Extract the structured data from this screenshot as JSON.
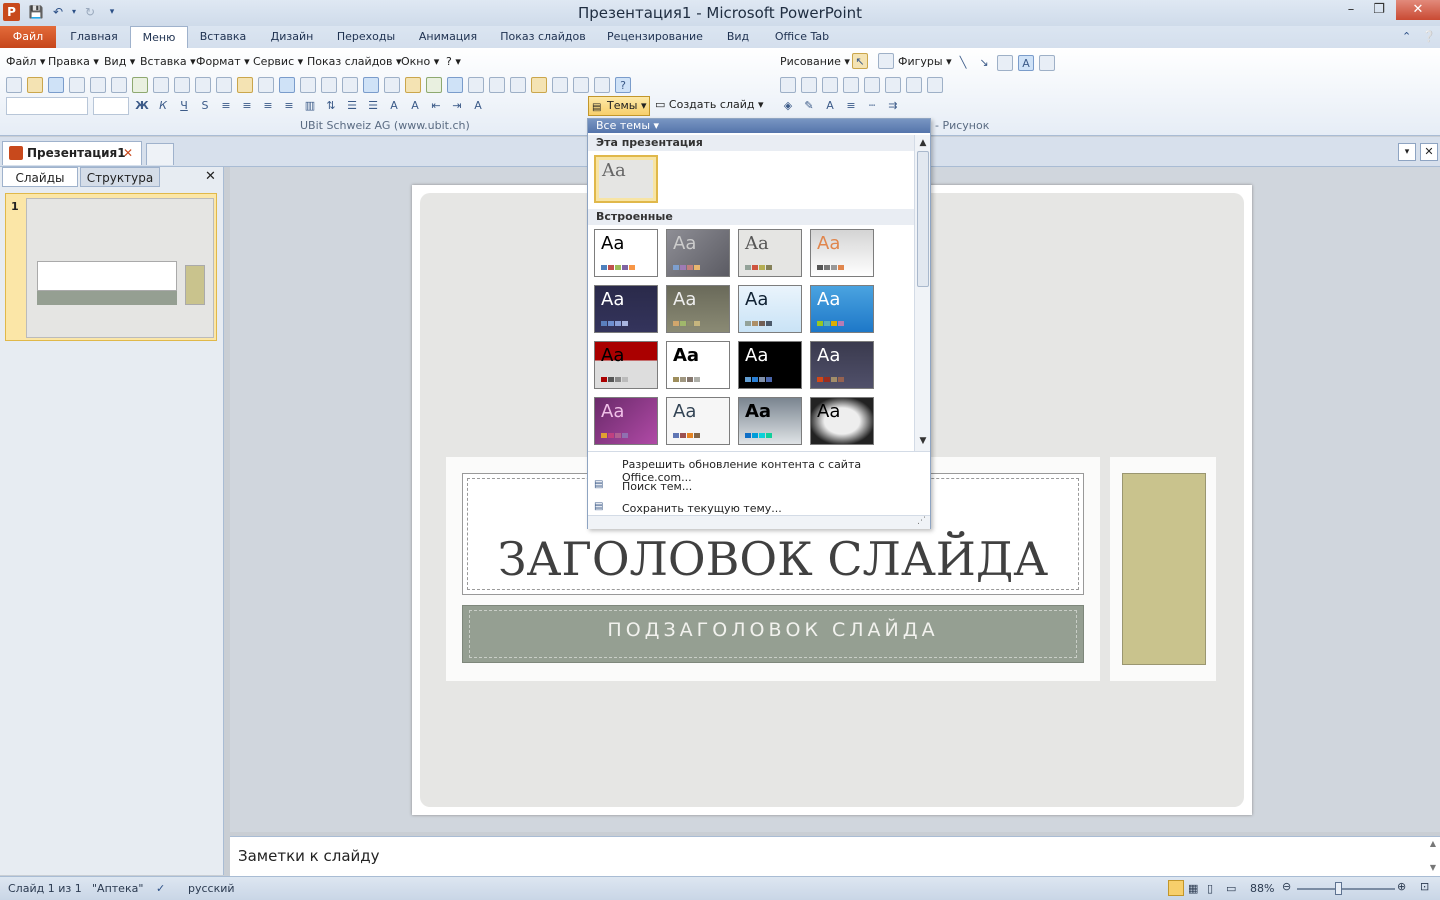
{
  "window": {
    "title": "Презентация1 - Microsoft PowerPoint",
    "app_icon_letter": "P"
  },
  "ribbon_tabs": [
    "Файл",
    "Главная",
    "Меню",
    "Вставка",
    "Дизайн",
    "Переходы",
    "Анимация",
    "Показ слайдов",
    "Рецензирование",
    "Вид",
    "Office Tab"
  ],
  "active_tab": "Меню",
  "menu_bar": [
    "Файл",
    "Правка",
    "Вид",
    "Вставка",
    "Формат",
    "Сервис",
    "Показ слайдов",
    "Окно",
    "?"
  ],
  "ribbon": {
    "caption": "UBit Schweiz AG    (www.ubit.ch)",
    "picture_group": "Рисунок",
    "drawing_label": "Рисование",
    "shapes_label": "Фигуры",
    "themes_button": "Темы",
    "create_slide_button": "Создать слайд"
  },
  "document_tab": "Презентация1",
  "left_pane": {
    "tabs": [
      "Слайды",
      "Структура"
    ],
    "slide_number": "1"
  },
  "themes_dropdown": {
    "header": "Все темы",
    "section_this": "Эта презентация",
    "section_builtin": "Встроенные",
    "aa_label": "Aa",
    "actions": [
      "Разрешить обновление контента с сайта Office.com...",
      "Поиск тем...",
      "Сохранить текущую тему..."
    ]
  },
  "slide": {
    "title": "ЗАГОЛОВОК СЛАЙДА",
    "subtitle": "ПОДЗАГОЛОВОК СЛАЙДА"
  },
  "notes": {
    "placeholder": "Заметки к слайду"
  },
  "status": {
    "slide_info": "Слайд 1 из 1",
    "theme_name": "\"Аптека\"",
    "language": "русский",
    "zoom": "88%"
  },
  "colors": {
    "accent": "#c6461b",
    "subtitle_band": "#959f92",
    "rect": "#c9c38d"
  }
}
